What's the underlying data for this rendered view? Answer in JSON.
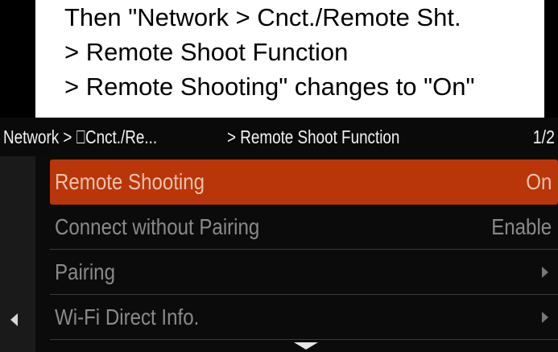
{
  "instruction": {
    "lines": [
      "Then \"Network > Cnct./Remote Sht.",
      "> Remote Shoot Function",
      "> Remote Shooting\" changes to \"On\""
    ]
  },
  "header": {
    "breadcrumb_1": "Network > ⎕Cnct./Re...",
    "breadcrumb_2": "> Remote Shoot Function",
    "page_indicator": "1/2"
  },
  "menu": {
    "items": [
      {
        "label": "Remote Shooting",
        "value": "On",
        "selected": true
      },
      {
        "label": "Connect without Pairing",
        "value": "Enable",
        "selected": false
      },
      {
        "label": "Pairing",
        "icon": "chevron-right-icon",
        "selected": false
      },
      {
        "label": "Wi-Fi Direct Info.",
        "icon": "chevron-right-icon",
        "selected": false
      }
    ]
  },
  "nav": {
    "back_icon": "triangle-left-icon",
    "scroll_icon": "triangle-down-icon"
  },
  "colors": {
    "selected_background": "#b8360a",
    "menu_text": "#8a8a8a",
    "header_text": "#f2f2f2",
    "background": "#0b0b0b"
  }
}
